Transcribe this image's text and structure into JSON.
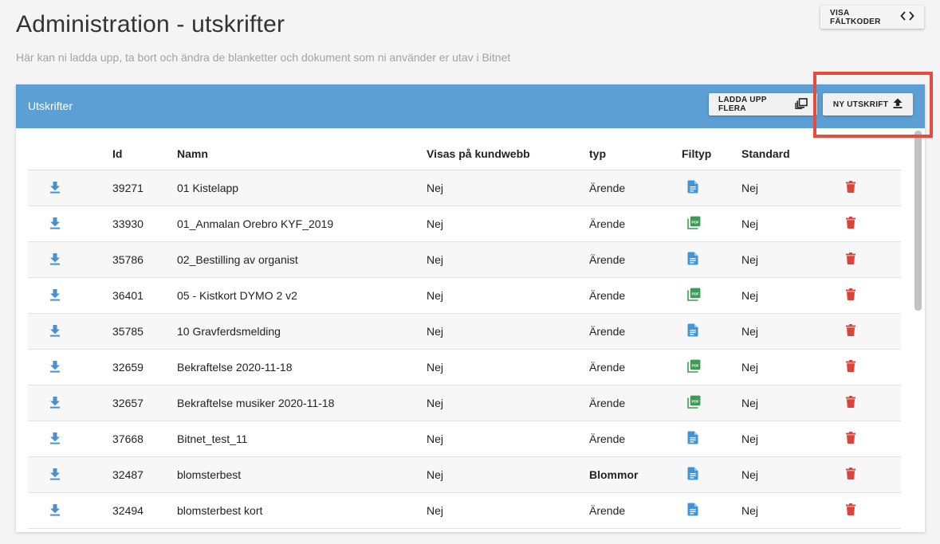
{
  "page": {
    "title": "Administration - utskrifter",
    "subtitle": "Här kan ni ladda upp, ta bort och ändra de blanketter och dokument som ni använder er utav i Bitnet",
    "fieldcodes_button": "VISA FÄLTKODER"
  },
  "card": {
    "title": "Utskrifter",
    "upload_many_button": "LADDA UPP FLERA",
    "new_button": "NY UTSKRIFT"
  },
  "table": {
    "columns": [
      "",
      "Id",
      "Namn",
      "Visas på kundwebb",
      "typ",
      "Filtyp",
      "Standard",
      ""
    ],
    "rows": [
      {
        "id": "39271",
        "name": "01 Kistelapp",
        "web": "Nej",
        "type": "Ärende",
        "type_bold": false,
        "filetype": "doc",
        "standard": "Nej"
      },
      {
        "id": "33930",
        "name": "01_Anmalan Orebro KYF_2019",
        "web": "Nej",
        "type": "Ärende",
        "type_bold": false,
        "filetype": "pdf",
        "standard": "Nej"
      },
      {
        "id": "35786",
        "name": "02_Bestilling av organist",
        "web": "Nej",
        "type": "Ärende",
        "type_bold": false,
        "filetype": "doc",
        "standard": "Nej"
      },
      {
        "id": "36401",
        "name": "05 - Kistkort DYMO 2 v2",
        "web": "Nej",
        "type": "Ärende",
        "type_bold": false,
        "filetype": "pdf",
        "standard": "Nej"
      },
      {
        "id": "35785",
        "name": "10 Gravferdsmelding",
        "web": "Nej",
        "type": "Ärende",
        "type_bold": false,
        "filetype": "doc",
        "standard": "Nej"
      },
      {
        "id": "32659",
        "name": "Bekraftelse 2020-11-18",
        "web": "Nej",
        "type": "Ärende",
        "type_bold": false,
        "filetype": "pdf",
        "standard": "Nej"
      },
      {
        "id": "32657",
        "name": "Bekraftelse musiker 2020-11-18",
        "web": "Nej",
        "type": "Ärende",
        "type_bold": false,
        "filetype": "pdf",
        "standard": "Nej"
      },
      {
        "id": "37668",
        "name": "Bitnet_test_11",
        "web": "Nej",
        "type": "Ärende",
        "type_bold": false,
        "filetype": "doc",
        "standard": "Nej"
      },
      {
        "id": "32487",
        "name": "blomsterbest",
        "web": "Nej",
        "type": "Blommor",
        "type_bold": true,
        "filetype": "doc",
        "standard": "Nej"
      },
      {
        "id": "32494",
        "name": "blomsterbest kort",
        "web": "Nej",
        "type": "Ärende",
        "type_bold": false,
        "filetype": "doc",
        "standard": "Nej"
      }
    ]
  },
  "icons": {
    "download": "download-icon",
    "doc": "document-icon",
    "pdf": "pdf-icon",
    "delete": "trash-icon",
    "code": "code-brackets-icon",
    "upload_many": "library-icon",
    "upload": "upload-icon"
  },
  "colors": {
    "header": "#5c9fd4",
    "highlight": "#e64b40",
    "download_icon": "#4a90d0",
    "doc_icon": "#3f95d8",
    "pdf_icon": "#3e9a57",
    "delete_icon": "#d9453b"
  }
}
